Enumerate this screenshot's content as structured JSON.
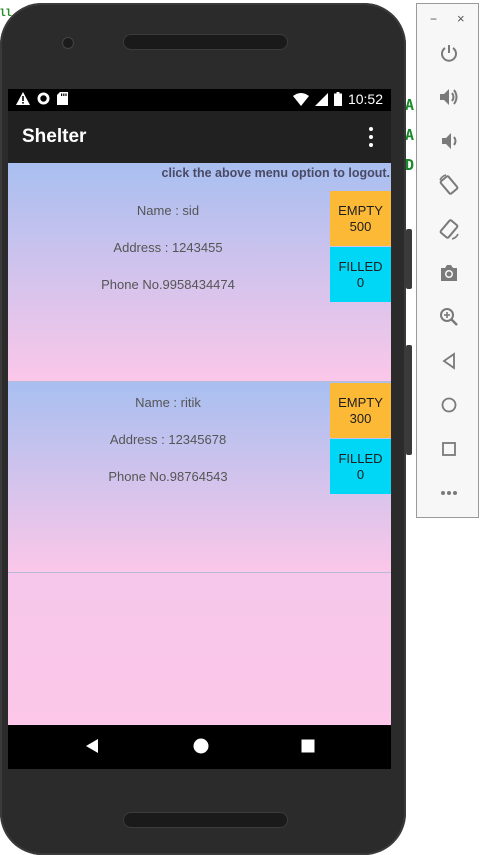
{
  "background_code": {
    "top_fragment": "ll",
    "fragment_1": "A'",
    "fragment_2": "A",
    "fragment_3": "D"
  },
  "status_bar": {
    "time": "10:52",
    "left_icons": [
      "warning-icon",
      "record-icon",
      "sd-card-icon"
    ],
    "right_icons": [
      "wifi-icon",
      "signal-icon",
      "battery-icon"
    ]
  },
  "app_bar": {
    "title": "Shelter",
    "menu_icon": "overflow-menu-icon"
  },
  "content": {
    "logout_hint": "click the above menu option to logout.",
    "cards": [
      {
        "name": "Name : sid",
        "address": "Address : 1243455",
        "phone": "Phone No.9958434474",
        "empty_label": "EMPTY",
        "empty_value": "500",
        "filled_label": "FILLED",
        "filled_value": "0"
      },
      {
        "name": "Name : ritik",
        "address": "Address : 12345678",
        "phone": "Phone No.98764543",
        "empty_label": "EMPTY",
        "empty_value": "300",
        "filled_label": "FILLED",
        "filled_value": "0"
      }
    ]
  },
  "nav_bar": {
    "icons": [
      "back-icon",
      "home-icon",
      "recents-icon"
    ]
  },
  "emulator_toolbar": {
    "minimize": "−",
    "close": "×",
    "tools": [
      "power-icon",
      "volume-up-icon",
      "volume-down-icon",
      "rotate-left-icon",
      "rotate-right-icon",
      "screenshot-icon",
      "zoom-icon",
      "back-icon",
      "home-icon",
      "overview-icon",
      "more-icon"
    ]
  },
  "colors": {
    "app_bar": "#212121",
    "empty_button": "#fcb936",
    "filled_button": "#00d6f6",
    "card_gradient_top": "#a8bff0",
    "card_gradient_bottom": "#fbc7e9"
  }
}
